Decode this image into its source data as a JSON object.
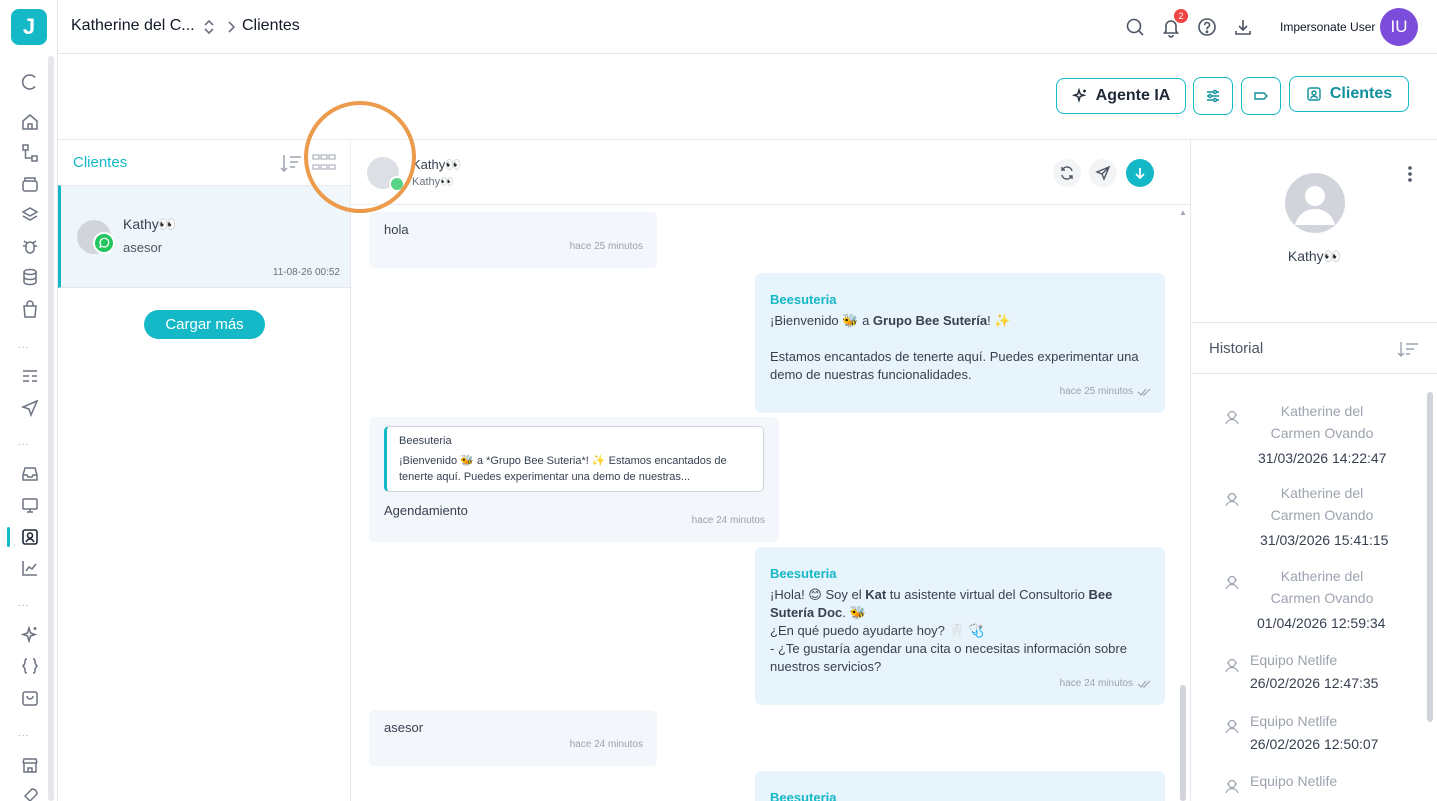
{
  "app": {
    "logo_letter": "J"
  },
  "topbar": {
    "workspace": "Katherine del C...",
    "page": "Clientes",
    "notifications_count": "2",
    "user_label": "Impersonate User",
    "avatar_initials": "IU"
  },
  "actions": {
    "agent_label": "Agente IA",
    "clients_label": "Clientes"
  },
  "client_list": {
    "title": "Clientes",
    "items": [
      {
        "name": "Kathy👀",
        "subtitle": "asesor",
        "date": "11-08-26 00:52"
      }
    ],
    "load_more": "Cargar más"
  },
  "chat": {
    "contact_name": "Kathy👀",
    "contact_sub": "Kathy👀",
    "messages": [
      {
        "direction": "in",
        "text": "hola",
        "time": "hace 25 minutos"
      },
      {
        "direction": "out",
        "sender": "Beesuteria",
        "line1_pre": "¡Bienvenido 🐝 a ",
        "line1_bold": "Grupo Bee Sutería",
        "line1_post": "! ✨",
        "line2": "Estamos encantados de tenerte aquí. Puedes experimentar una demo de nuestras funcionalidades.",
        "time": "hace 25 minutos"
      },
      {
        "direction": "in",
        "quote_sender": "Beesuteria",
        "quote_text": "¡Bienvenido 🐝 a *Grupo Bee Suteria*! ✨ Estamos encantados de tenerte aquí. Puedes experimentar una demo de nuestras...",
        "text": "Agendamiento",
        "time": "hace 24 minutos"
      },
      {
        "direction": "out",
        "sender": "Beesuteria",
        "l1_a": "¡Hola! 😊 Soy el ",
        "l1_b": "Kat",
        "l1_c": " tu asistente virtual del Consultorio ",
        "l1_d": "Bee Sutería Doc",
        "l1_e": ". 🐝",
        "l2": "¿En qué puedo ayudarte hoy? 🦷 🩺",
        "l3": "- ¿Te gustaría agendar una cita o necesitas información sobre nuestros servicios?",
        "time": "hace 24 minutos"
      },
      {
        "direction": "in",
        "text": "asesor",
        "time": "hace 24 minutos"
      },
      {
        "direction": "out",
        "sender": "Beesuteria"
      }
    ]
  },
  "contact_panel": {
    "name": "Kathy👀",
    "history_title": "Historial",
    "history": [
      {
        "name_l1": "Katherine del",
        "name_l2": "Carmen Ovando",
        "date": "31/03/2026 14:22:47"
      },
      {
        "name_l1": "Katherine del",
        "name_l2": "Carmen Ovando",
        "date": "31/03/2026 15:41:15"
      },
      {
        "name_l1": "Katherine del",
        "name_l2": "Carmen Ovando",
        "date": "01/04/2026 12:59:34"
      },
      {
        "name_l1": "Equipo Netlife",
        "date": "26/02/2026 12:47:35"
      },
      {
        "name_l1": "Equipo Netlife",
        "date": "26/02/2026 12:50:07"
      },
      {
        "name_l1": "Equipo Netlife"
      }
    ]
  },
  "colors": {
    "accent": "#14b8c6",
    "avatar": "#7c4ddb",
    "badge": "#ef4444",
    "highlight": "#ec9a4c"
  }
}
